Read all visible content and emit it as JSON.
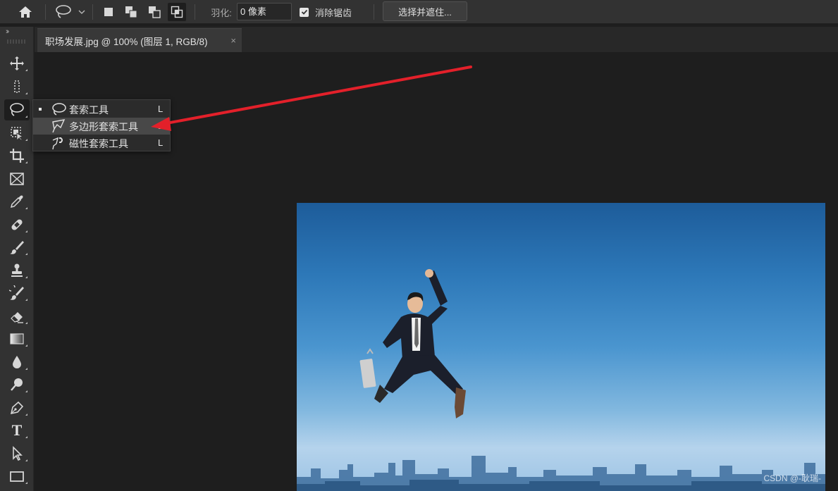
{
  "options_bar": {
    "feather_label": "羽化:",
    "feather_value": "0 像素",
    "anti_alias_label": "消除锯齿",
    "anti_alias_checked": true,
    "select_and_mask_label": "选择并遮住..."
  },
  "document_tab": {
    "title": "职场发展.jpg @ 100% (图层 1, RGB/8)",
    "close_glyph": "×"
  },
  "collapse_glyph": "››",
  "toolbar": {
    "tools": [
      {
        "name": "move-tool",
        "icon": "move-icon"
      },
      {
        "name": "marquee-tool",
        "icon": "marquee-icon"
      },
      {
        "name": "lasso-tool",
        "icon": "lasso-icon",
        "active": true
      },
      {
        "name": "object-selection-tool",
        "icon": "object-selection-icon"
      },
      {
        "name": "crop-tool",
        "icon": "crop-icon"
      },
      {
        "name": "frame-tool",
        "icon": "frame-icon"
      },
      {
        "name": "eyedropper-tool",
        "icon": "eyedropper-icon"
      },
      {
        "name": "healing-brush-tool",
        "icon": "bandage-icon"
      },
      {
        "name": "brush-tool",
        "icon": "brush-icon"
      },
      {
        "name": "clone-stamp-tool",
        "icon": "stamp-icon"
      },
      {
        "name": "history-brush-tool",
        "icon": "history-brush-icon"
      },
      {
        "name": "eraser-tool",
        "icon": "eraser-icon"
      },
      {
        "name": "gradient-tool",
        "icon": "gradient-icon"
      },
      {
        "name": "blur-tool",
        "icon": "drop-icon"
      },
      {
        "name": "dodge-tool",
        "icon": "dodge-icon"
      },
      {
        "name": "pen-tool",
        "icon": "pen-icon"
      },
      {
        "name": "type-tool",
        "icon": "type-icon",
        "glyph": "T"
      },
      {
        "name": "path-selection-tool",
        "icon": "arrow-icon"
      },
      {
        "name": "rectangle-tool",
        "icon": "rectangle-icon"
      }
    ]
  },
  "lasso_flyout": {
    "items": [
      {
        "label": "套索工具",
        "shortcut": "L",
        "current": true,
        "icon": "lasso-icon"
      },
      {
        "label": "多边形套索工具",
        "shortcut": "L",
        "hover": true,
        "icon": "polygonal-lasso-icon"
      },
      {
        "label": "磁性套索工具",
        "shortcut": "L",
        "icon": "magnetic-lasso-icon"
      }
    ]
  },
  "canvas": {
    "watermark": "CSDN @-耿瑞-"
  },
  "colors": {
    "annotation_arrow": "#e3202a",
    "panel_bg": "#323232",
    "canvas_bg": "#1e1e1e"
  }
}
